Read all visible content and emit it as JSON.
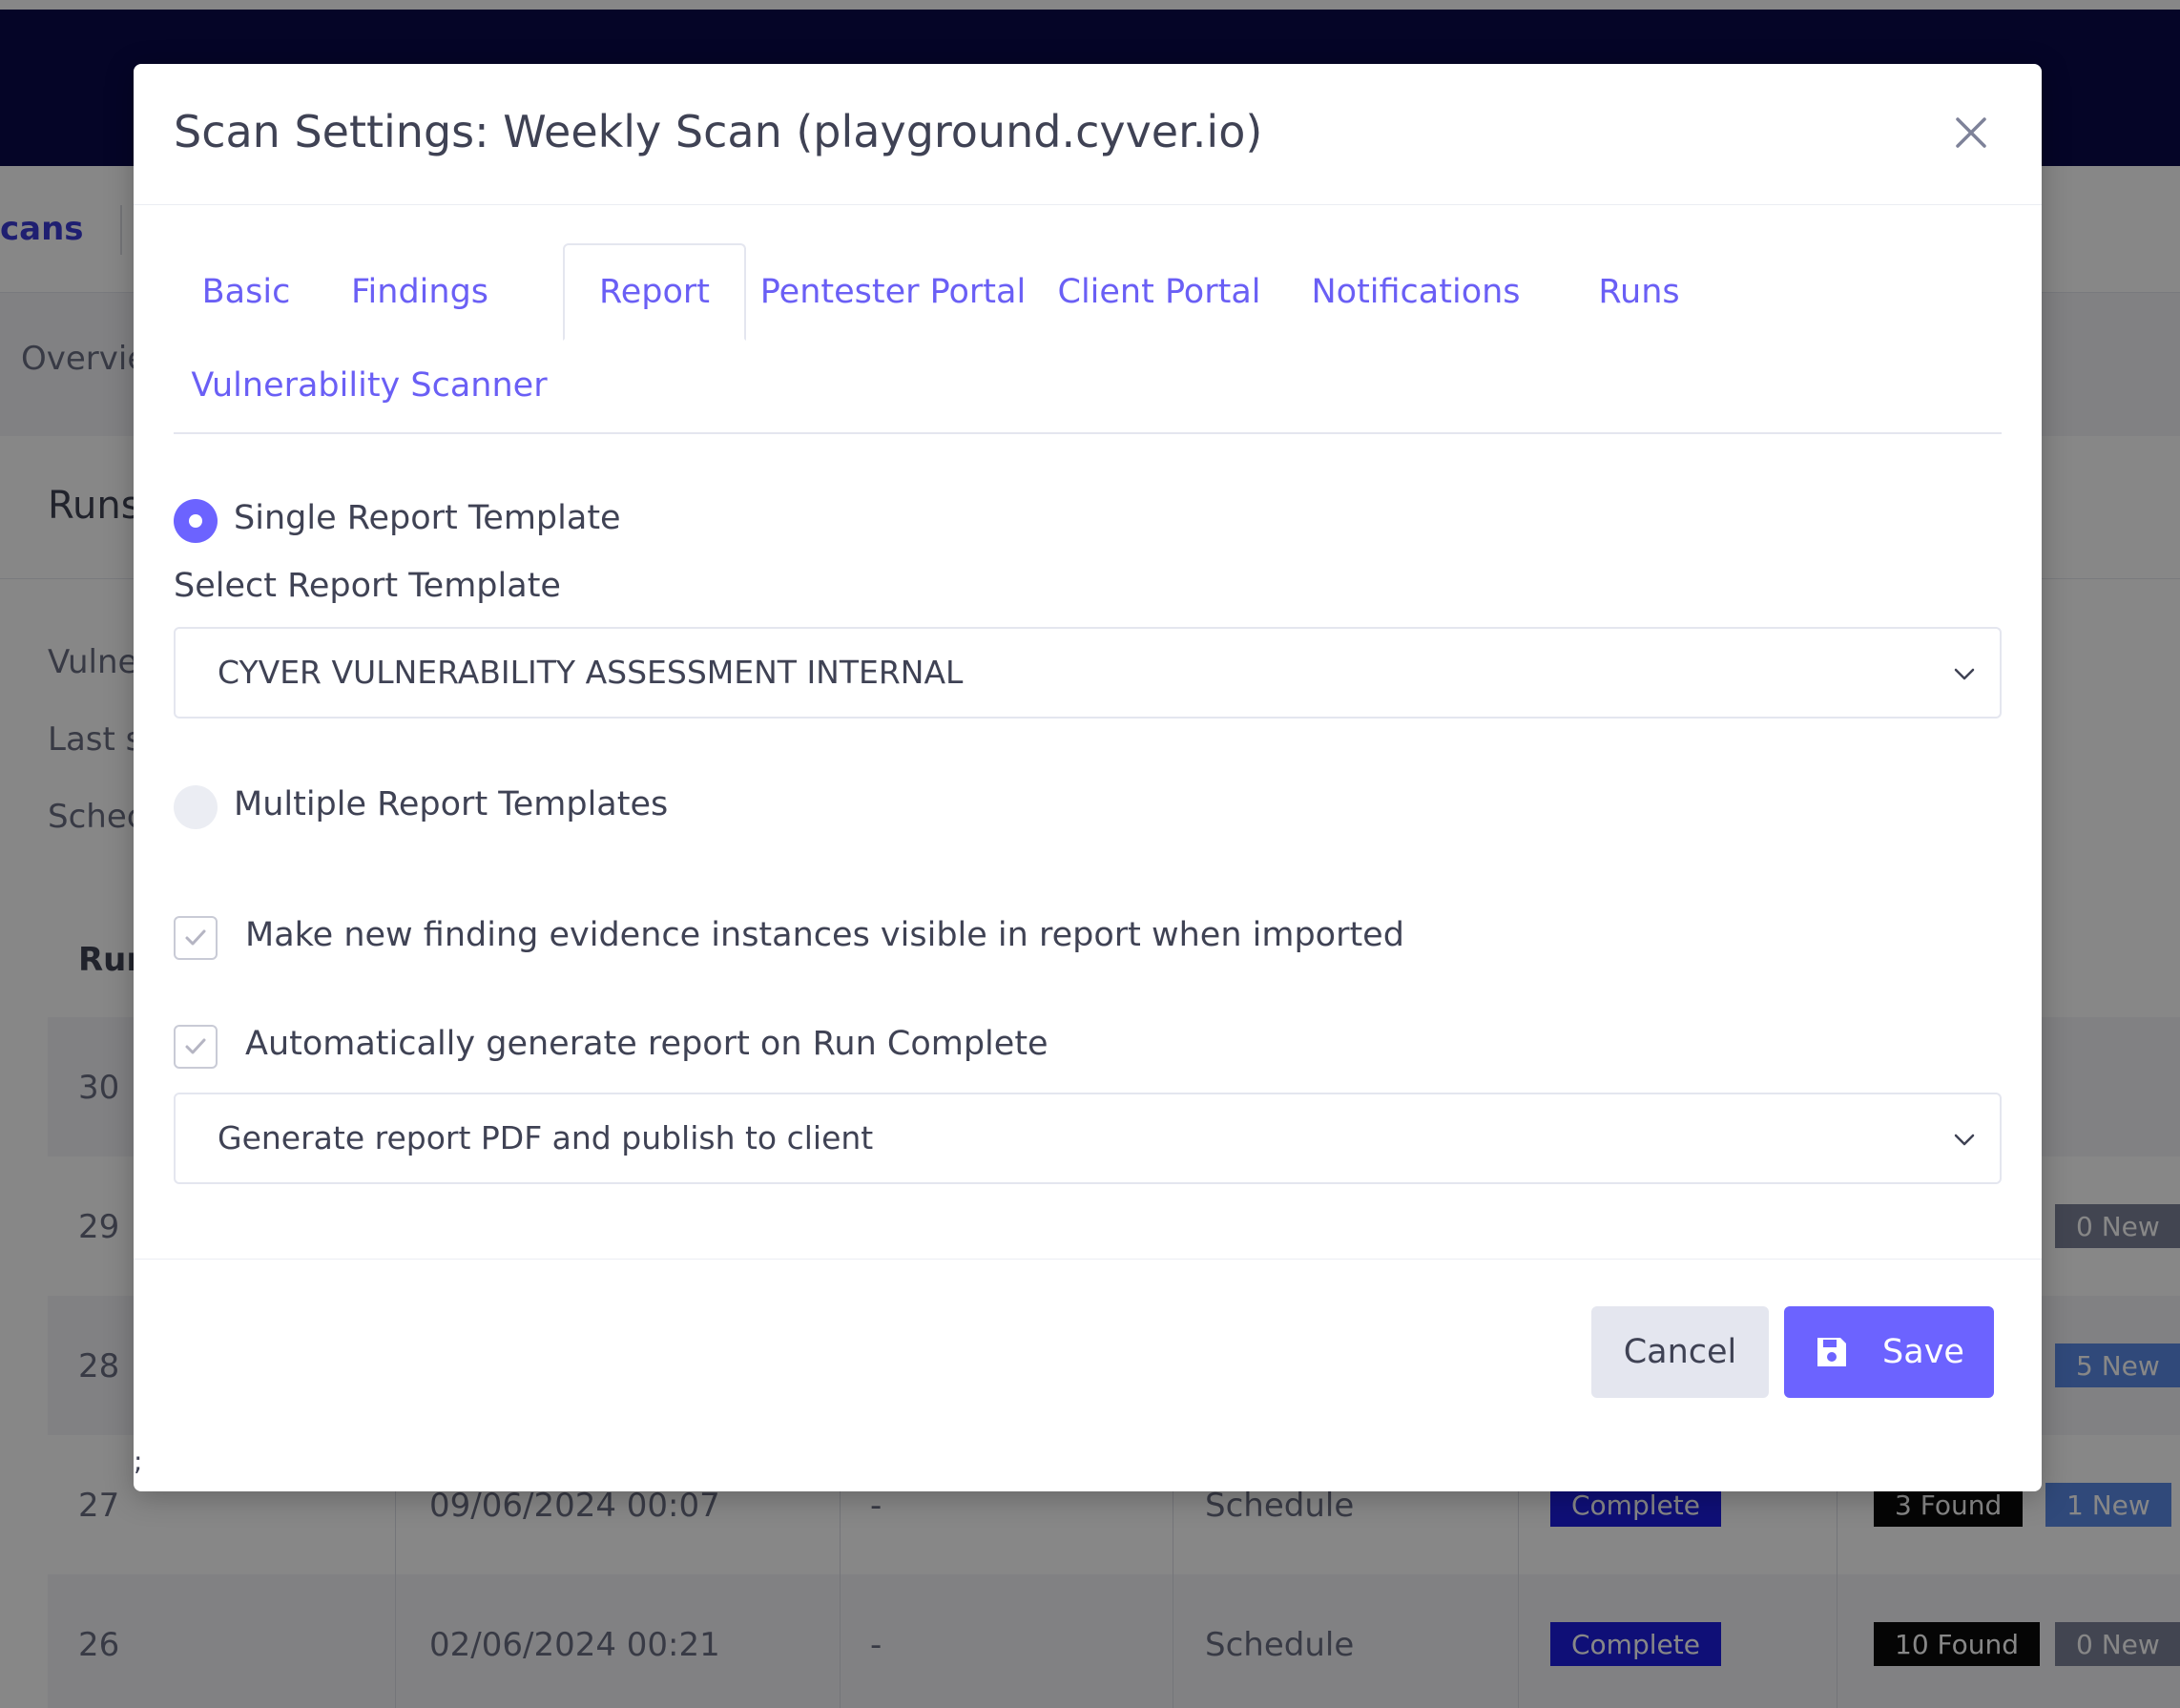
{
  "background": {
    "nav_partial": "cans",
    "tab_partial": "Overvie",
    "section_partial": "Runs",
    "info_labels": [
      "Vulne",
      "Last s",
      "Schec"
    ],
    "table_header_partial": "Run",
    "rows": [
      {
        "id": "30",
        "date": "",
        "dash": "",
        "source": "",
        "status": "",
        "found": "",
        "new": ""
      },
      {
        "id": "29",
        "date": "",
        "dash": "",
        "source": "",
        "status": "",
        "found": "",
        "new": "0 New"
      },
      {
        "id": "28",
        "date": "",
        "dash": "",
        "source": "",
        "status": "",
        "found": "",
        "new": "5 New"
      },
      {
        "id": "27",
        "date": "09/06/2024 00:07",
        "dash": "-",
        "source": "Schedule",
        "status": "Complete",
        "found": "3 Found",
        "new": "1 New"
      },
      {
        "id": "26",
        "date": "02/06/2024 00:21",
        "dash": "-",
        "source": "Schedule",
        "status": "Complete",
        "found": "10 Found",
        "new": "0 New"
      }
    ]
  },
  "modal": {
    "title": "Scan Settings: Weekly Scan (playground.cyver.io)",
    "tabs": [
      {
        "label": "Basic"
      },
      {
        "label": "Findings"
      },
      {
        "label": "Report"
      },
      {
        "label": "Pentester Portal"
      },
      {
        "label": "Client Portal"
      },
      {
        "label": "Notifications"
      },
      {
        "label": "Runs"
      },
      {
        "label": "Vulnerability Scanner"
      }
    ],
    "single_template_label": "Single Report Template",
    "select_template_label": "Select Report Template",
    "template_value": "CYVER VULNERABILITY ASSESSMENT INTERNAL",
    "multiple_templates_label": "Multiple Report Templates",
    "evidence_visible_label": "Make new finding evidence instances visible in report when imported",
    "auto_generate_label": "Automatically generate report on Run Complete",
    "generate_action_value": "Generate report PDF and publish to client",
    "cancel_label": "Cancel",
    "save_label": "Save",
    "stray_text": ";"
  },
  "colors": {
    "accent": "#6c63ff",
    "tab_text": "#6a5ff5",
    "header_bg": "#0b0b4a",
    "status_complete": "#1d1ee0"
  },
  "icons": {
    "close": "close-icon",
    "chevron": "chevron-down-icon",
    "check": "check-icon",
    "save": "floppy-disk-icon"
  }
}
